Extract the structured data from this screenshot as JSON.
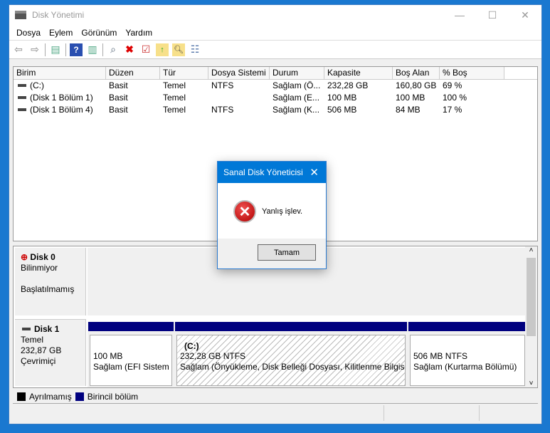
{
  "window": {
    "title": "Disk Yönetimi",
    "minimize": "—",
    "maximize": "☐",
    "close": "✕"
  },
  "menu": [
    "Dosya",
    "Eylem",
    "Görünüm",
    "Yardım"
  ],
  "toolbar": [
    "back-icon",
    "forward-icon",
    "console-tree-icon",
    "help-icon",
    "action-pane-icon",
    "connect-disk-icon",
    "delete-icon",
    "properties-icon",
    "open-icon",
    "explore-icon",
    "checklist-icon"
  ],
  "table": {
    "columns": [
      "Birim",
      "Düzen",
      "Tür",
      "Dosya Sistemi",
      "Durum",
      "Kapasite",
      "Boş Alan",
      "% Boş"
    ],
    "rows": [
      [
        "(C:)",
        "Basit",
        "Temel",
        "NTFS",
        "Sağlam (Ö...",
        "232,28 GB",
        "160,80 GB",
        "69 %"
      ],
      [
        "(Disk 1 Bölüm 1)",
        "Basit",
        "Temel",
        "",
        "Sağlam (E...",
        "100 MB",
        "100 MB",
        "100 %"
      ],
      [
        "(Disk 1 Bölüm 4)",
        "Basit",
        "Temel",
        "NTFS",
        "Sağlam (K...",
        "506 MB",
        "84 MB",
        "17 %"
      ]
    ]
  },
  "disks": [
    {
      "name": "Disk 0",
      "lines": [
        "Bilinmiyor",
        "",
        "Başlatılmamış"
      ]
    },
    {
      "name": "Disk 1",
      "lines": [
        "Temel",
        "232,87 GB",
        "Çevrimiçi"
      ],
      "partitions": [
        {
          "title": "",
          "size": "100 MB",
          "status": "Sağlam (EFI Sistem Bölümü)"
        },
        {
          "title": "(C:)",
          "size": "232,28 GB NTFS",
          "status": "Sağlam (Önyükleme, Disk Belleği Dosyası, Kilitlenme Bilgisi, Birincil Bölüm)"
        },
        {
          "title": "",
          "size": "506 MB NTFS",
          "status": "Sağlam (Kurtarma Bölümü)"
        }
      ]
    }
  ],
  "legend": [
    {
      "label": "Ayrılmamış",
      "color": "#000000"
    },
    {
      "label": "Birincil bölüm",
      "color": "#00007f"
    }
  ],
  "dialog": {
    "title": "Sanal Disk Yöneticisi",
    "message": "Yanlış işlev.",
    "ok": "Tamam",
    "icon": "error-icon"
  }
}
